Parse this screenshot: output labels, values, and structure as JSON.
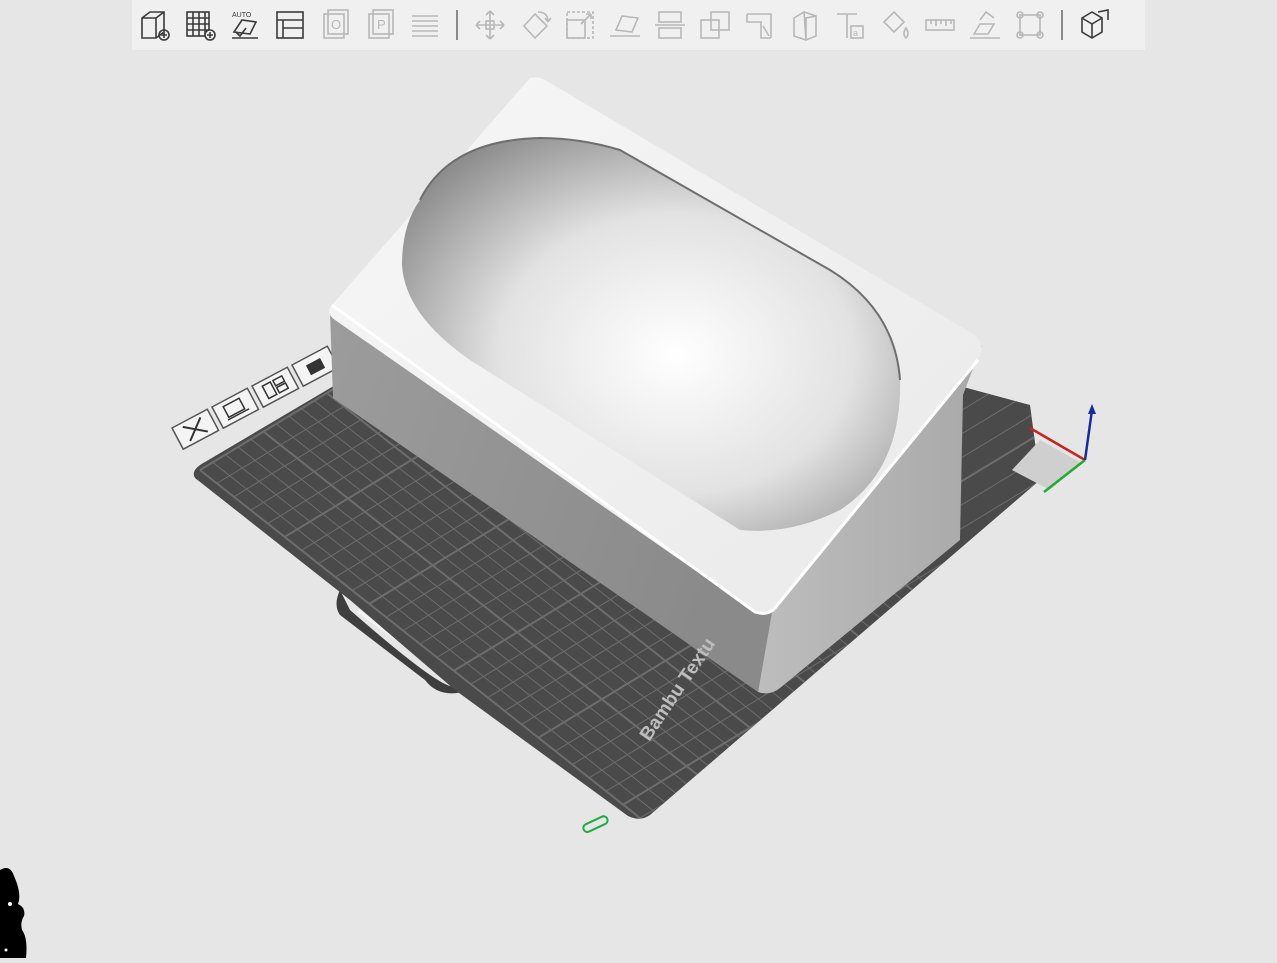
{
  "toolbar": {
    "groups": [
      [
        {
          "name": "add-object-icon",
          "enabled": true
        },
        {
          "name": "add-plate-icon",
          "enabled": true
        },
        {
          "name": "auto-orient-icon",
          "enabled": true,
          "badge": "AUTO"
        },
        {
          "name": "arrange-icon",
          "enabled": true
        }
      ],
      [
        {
          "name": "split-objects-icon",
          "enabled": false
        },
        {
          "name": "split-parts-icon",
          "enabled": false
        },
        {
          "name": "layers-icon",
          "enabled": false
        }
      ],
      [
        {
          "name": "move-icon",
          "enabled": false
        },
        {
          "name": "rotate-icon",
          "enabled": false
        },
        {
          "name": "scale-icon",
          "enabled": false
        },
        {
          "name": "lay-on-face-icon",
          "enabled": false
        },
        {
          "name": "cut-icon",
          "enabled": false
        },
        {
          "name": "boolean-icon",
          "enabled": false
        },
        {
          "name": "support-paint-icon",
          "enabled": false
        },
        {
          "name": "seam-paint-icon",
          "enabled": false
        },
        {
          "name": "text-emboss-icon",
          "enabled": false
        },
        {
          "name": "color-paint-icon",
          "enabled": false
        },
        {
          "name": "measure-icon",
          "enabled": false
        },
        {
          "name": "assemble-icon",
          "enabled": false
        },
        {
          "name": "brim-ears-icon",
          "enabled": false
        }
      ],
      [
        {
          "name": "assembly-view-icon",
          "enabled": true
        }
      ]
    ],
    "colors": {
      "enabled": "#3a3a3a",
      "disabled": "#b8b8b8",
      "background": "#f0f0f0"
    }
  },
  "plate": {
    "label": "Bambu Textu",
    "plate_number": "0",
    "colors": {
      "surface": "#4a4a4a",
      "grid": "#6a6a6a",
      "model": "#e8e8e8"
    }
  },
  "plate_controls": [
    {
      "name": "plate-delete-icon"
    },
    {
      "name": "plate-orient-icon"
    },
    {
      "name": "plate-arrange-icon"
    },
    {
      "name": "plate-lock-icon"
    }
  ],
  "axes": {
    "x_color": "#cc2222",
    "y_color": "#22aa33",
    "z_color": "#1a2a9a"
  }
}
